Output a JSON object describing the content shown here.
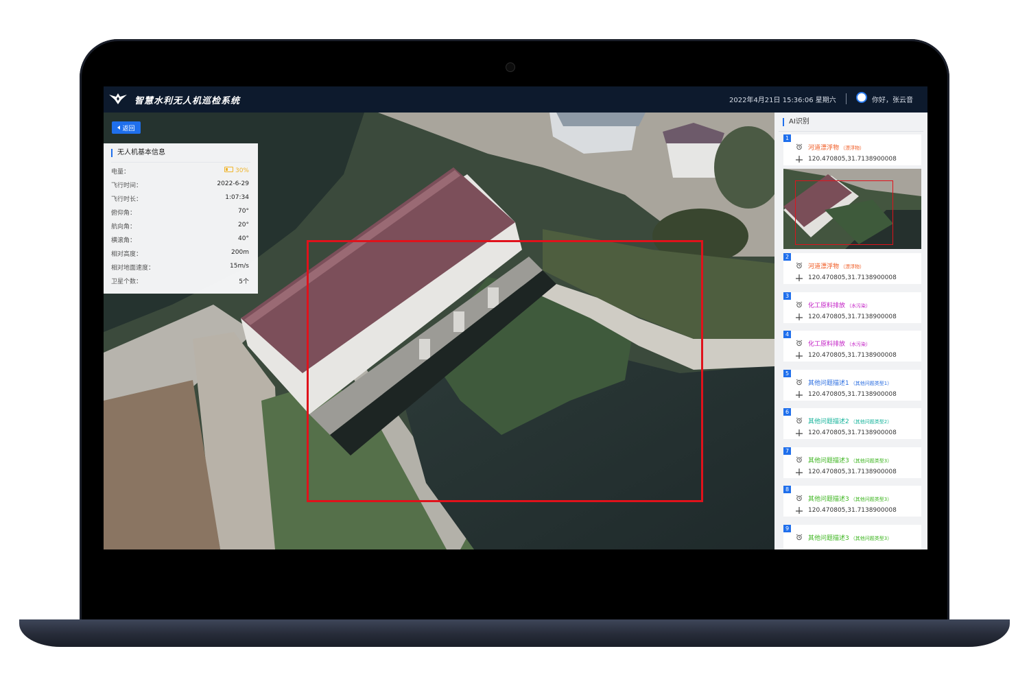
{
  "header": {
    "app_title": "智慧水利无人机巡检系统",
    "datetime": "2022年4月21日   15:36:06   星期六",
    "greeting": "你好，张云音"
  },
  "map": {
    "back_label": "返回"
  },
  "info_panel": {
    "title": "无人机基本信息",
    "battery_label": "电量：",
    "battery_value": "30%",
    "rows": [
      {
        "label": "飞行时间：",
        "value": "2022-6-29"
      },
      {
        "label": "飞行时长：",
        "value": "1:07:34"
      },
      {
        "label": "俯仰角：",
        "value": "70°"
      },
      {
        "label": "航向角：",
        "value": "20°"
      },
      {
        "label": "横滚角：",
        "value": "40°"
      },
      {
        "label": "相对高度：",
        "value": "200m"
      },
      {
        "label": "相对地面速度：",
        "value": "15m/s"
      },
      {
        "label": "卫星个数：",
        "value": "5个"
      }
    ]
  },
  "ai_panel": {
    "title": "AI识别",
    "items": [
      {
        "num": "1",
        "name": "河道漂浮物",
        "type": "（漂浮物）",
        "coord": "120.470805,31.7138900008",
        "color": "#f05a22"
      },
      {
        "num": "2",
        "name": "河道漂浮物",
        "type": "（漂浮物）",
        "coord": "120.470805,31.7138900008",
        "color": "#f05a22"
      },
      {
        "num": "3",
        "name": "化工原料排放",
        "type": "（水污染）",
        "coord": "120.470805,31.7138900008",
        "color": "#c21cc4"
      },
      {
        "num": "4",
        "name": "化工原料排放",
        "type": "（水污染）",
        "coord": "120.470805,31.7138900008",
        "color": "#c21cc4"
      },
      {
        "num": "5",
        "name": "其他问题描述1",
        "type": "（其他问题类型1）",
        "coord": "120.470805,31.7138900008",
        "color": "#2a6de0"
      },
      {
        "num": "6",
        "name": "其他问题描述2",
        "type": "（其他问题类型2）",
        "coord": "120.470805,31.7138900008",
        "color": "#14b39a"
      },
      {
        "num": "7",
        "name": "其他问题描述3",
        "type": "（其他问题类型3）",
        "coord": "120.470805,31.7138900008",
        "color": "#3cb51f"
      },
      {
        "num": "8",
        "name": "其他问题描述3",
        "type": "（其他问题类型3）",
        "coord": "120.470805,31.7138900008",
        "color": "#3cb51f"
      },
      {
        "num": "9",
        "name": "其他问题描述3",
        "type": "（其他问题类型3）",
        "coord": "",
        "color": "#3cb51f"
      }
    ]
  }
}
